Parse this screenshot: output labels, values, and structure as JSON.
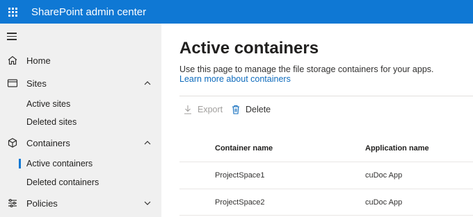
{
  "header": {
    "app_title": "SharePoint admin center"
  },
  "sidebar": {
    "items": [
      {
        "label": "Home",
        "icon": "home-icon"
      },
      {
        "label": "Sites",
        "icon": "sites-icon",
        "expanded": true,
        "children": [
          {
            "label": "Active sites"
          },
          {
            "label": "Deleted sites"
          }
        ]
      },
      {
        "label": "Containers",
        "icon": "cube-icon",
        "expanded": true,
        "children": [
          {
            "label": "Active containers",
            "selected": true
          },
          {
            "label": "Deleted containers"
          }
        ]
      },
      {
        "label": "Policies",
        "icon": "sliders-icon",
        "expanded": false
      }
    ]
  },
  "main": {
    "title": "Active containers",
    "description": "Use this page to manage the file storage containers for your apps.",
    "learn_more": "Learn more about containers",
    "commands": {
      "export": "Export",
      "delete": "Delete"
    },
    "table": {
      "columns": [
        "Container name",
        "Application name"
      ],
      "rows": [
        [
          "ProjectSpace1",
          "cuDoc App"
        ],
        [
          "ProjectSpace2",
          "cuDoc App"
        ]
      ]
    }
  },
  "colors": {
    "brand": "#0f78d4",
    "link": "#0f6cbd",
    "sidebar_bg": "#f0f0f0"
  }
}
